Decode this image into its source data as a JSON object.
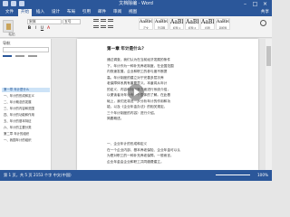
{
  "window": {
    "title": "文档除编 - Word",
    "controls": [
      "–",
      "□",
      "×"
    ]
  },
  "tabs": [
    {
      "label": "文件",
      "active": false
    },
    {
      "label": "开始",
      "active": true
    },
    {
      "label": "插入",
      "active": false
    },
    {
      "label": "设计",
      "active": false
    },
    {
      "label": "布局",
      "active": false
    },
    {
      "label": "引用",
      "active": false
    },
    {
      "label": "邮件",
      "active": false
    },
    {
      "label": "审阅",
      "active": false
    },
    {
      "label": "视图",
      "active": false
    }
  ],
  "share_label": "共享",
  "ribbon": {
    "paste_label": "粘贴",
    "font_name": "宋体",
    "font_size": "五号",
    "format_buttons": [
      "B",
      "I",
      "U",
      "A"
    ],
    "styles": [
      {
        "preview": "AaBbCcDc",
        "name": "正文"
      },
      {
        "preview": "AaBbCcDc",
        "name": "无间隔"
      },
      {
        "preview": "AaBl",
        "name": "标题 1"
      },
      {
        "preview": "AaBb",
        "name": "标题 2"
      },
      {
        "preview": "AaBl",
        "name": "标题"
      },
      {
        "preview": "AaBbC",
        "name": "副标题"
      }
    ]
  },
  "navigation": {
    "title": "导航",
    "items": [
      {
        "label": "第一章 年计是什么",
        "selected": true
      },
      {
        "label": "一、年计的形成和定义",
        "selected": false
      },
      {
        "label": "二、年计概念的发展",
        "selected": false
      },
      {
        "label": "三、年计的内容和范围",
        "selected": false
      },
      {
        "label": "四、年计的功能和作用",
        "selected": false
      },
      {
        "label": "五、年计的基本特征",
        "selected": false
      },
      {
        "label": "六、年计的主要分类",
        "selected": false
      },
      {
        "label": "第二章 年计的组织",
        "selected": false
      },
      {
        "label": "一、我国年计的组织",
        "selected": false
      }
    ]
  },
  "document": {
    "heading": "第一章 年计是什么？",
    "paragraph": [
      "通过调查，我们认为在当前经济发展的条件",
      "下，年计作为一种补充养老制度，在全国范围",
      "内快速发展，企业和职工的参与度不断提",
      "高。年计制度的建立对于完善多层次养",
      "老保障体系具有重要意义。本章将从年计",
      "的定义、内容和特征等方面进行系统介绍，",
      "以便读者对年计有一个整体的了解。在此基",
      "础上，我们还将进一步分析年计的作用和功",
      "能，以及《企业年金办法》的相关规定。",
      "三个年计制度的内容）进行介绍。",
      "简要概述。"
    ],
    "section2": [
      "一、企业年计的形成和定义",
      "在一个企业内部，基本养老保险、企业年金可以认",
      "为是对职工的一种补充养老保障。一般而言，",
      "企业年金由企业和职工共同缴费建立。"
    ]
  },
  "status": {
    "text": "第 1 页，共 5 页   2153 个字   中文(中国)",
    "zoom": "100%"
  }
}
